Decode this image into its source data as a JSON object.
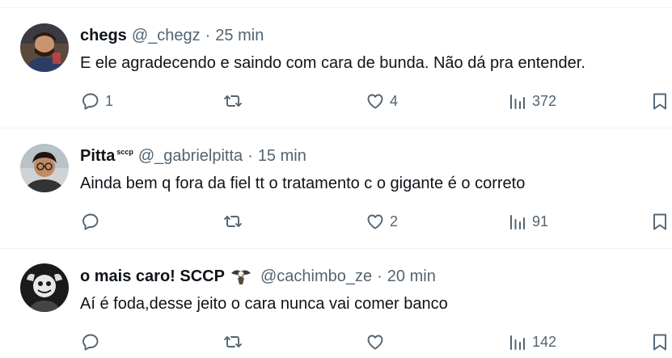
{
  "tweets": [
    {
      "name": "chegs",
      "name_suffix": "",
      "handle": "@_chegz",
      "separator": "·",
      "time": "25 min",
      "text": "E ele agradecendo e saindo com cara de bunda. Não dá pra entender.",
      "replies": "1",
      "retweets": "",
      "likes": "4",
      "views": "372"
    },
    {
      "name": "Pitta",
      "name_suffix": "sccp",
      "handle": "@_gabrielpitta",
      "separator": "·",
      "time": "15 min",
      "text": "Ainda bem q fora da fiel tt o tratamento c o gigante é o correto",
      "replies": "",
      "retweets": "",
      "likes": "2",
      "views": "91"
    },
    {
      "name": "o mais caro! SCCP",
      "name_suffix": "",
      "name_emoji": "eagle-emoji",
      "handle": "@cachimbo_ze",
      "separator": "·",
      "time": "20 min",
      "text": "Aí é foda,desse jeito o cara nunca vai comer banco",
      "replies": "",
      "retweets": "",
      "likes": "",
      "views": "142"
    }
  ],
  "icons": {
    "reply": "reply-icon",
    "retweet": "retweet-icon",
    "like": "heart-icon",
    "views": "views-icon",
    "bookmark": "bookmark-icon"
  },
  "colors": {
    "text": "#0f1419",
    "secondary": "#536471",
    "border": "#eff3f4"
  }
}
